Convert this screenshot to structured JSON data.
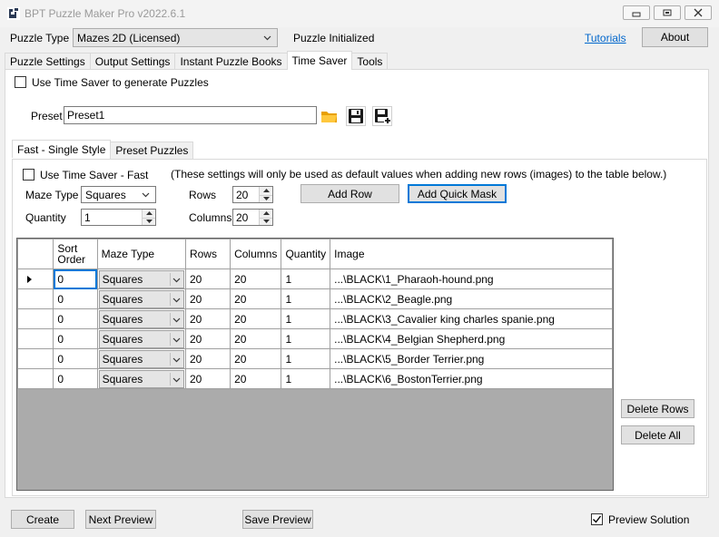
{
  "window": {
    "title": "BPT Puzzle Maker Pro v2022.6.1",
    "icon": "puzzle-app-icon",
    "controls": [
      "minimize-icon",
      "maximize-icon",
      "close-icon"
    ]
  },
  "top": {
    "puzzle_type_label": "Puzzle Type",
    "puzzle_type_value": "Mazes 2D (Licensed)",
    "status": "Puzzle Initialized",
    "tutorials_link": "Tutorials",
    "about_button": "About"
  },
  "main_tabs": [
    "Puzzle Settings",
    "Output Settings",
    "Instant Puzzle Books",
    "Time Saver",
    "Tools"
  ],
  "main_tabs_active": "Time Saver",
  "time_saver": {
    "use_checkbox_label": "Use Time Saver to generate Puzzles",
    "use_checked": false,
    "preset_label": "Preset",
    "preset_value": "Preset1",
    "preset_icons": [
      "open-folder-icon",
      "save-icon",
      "save-as-icon"
    ],
    "sub_tabs": [
      "Fast - Single Style",
      "Preset Puzzles"
    ],
    "sub_tabs_active": "Fast - Single Style",
    "fast": {
      "use_fast_label": "Use Time Saver - Fast",
      "use_fast_checked": false,
      "note": "(These settings will only be used as default values when adding new rows (images) to the table below.)",
      "maze_type_label": "Maze Type",
      "maze_type_value": "Squares",
      "quantity_label": "Quantity",
      "quantity_value": "1",
      "rows_label": "Rows",
      "rows_value": "20",
      "columns_label": "Columns",
      "columns_value": "20",
      "add_row_button": "Add Row",
      "add_quick_mask_button": "Add Quick Mask"
    },
    "table": {
      "columns": [
        "Sort Order",
        "Maze Type",
        "Rows",
        "Columns",
        "Quantity",
        "Image"
      ],
      "rows": [
        {
          "sort": "0",
          "maze_type": "Squares",
          "rows": "20",
          "columns": "20",
          "quantity": "1",
          "image": "...\\BLACK\\1_Pharaoh-hound.png"
        },
        {
          "sort": "0",
          "maze_type": "Squares",
          "rows": "20",
          "columns": "20",
          "quantity": "1",
          "image": "...\\BLACK\\2_Beagle.png"
        },
        {
          "sort": "0",
          "maze_type": "Squares",
          "rows": "20",
          "columns": "20",
          "quantity": "1",
          "image": "...\\BLACK\\3_Cavalier king charles spanie.png"
        },
        {
          "sort": "0",
          "maze_type": "Squares",
          "rows": "20",
          "columns": "20",
          "quantity": "1",
          "image": "...\\BLACK\\4_Belgian Shepherd.png"
        },
        {
          "sort": "0",
          "maze_type": "Squares",
          "rows": "20",
          "columns": "20",
          "quantity": "1",
          "image": "...\\BLACK\\5_Border Terrier.png"
        },
        {
          "sort": "0",
          "maze_type": "Squares",
          "rows": "20",
          "columns": "20",
          "quantity": "1",
          "image": "...\\BLACK\\6_BostonTerrier.png"
        }
      ]
    },
    "delete_rows_button": "Delete Rows",
    "delete_all_button": "Delete All"
  },
  "bottom": {
    "create_button": "Create",
    "next_preview_button": "Next Preview",
    "save_preview_button": "Save Preview",
    "preview_solution_label": "Preview Solution",
    "preview_solution_checked": true
  }
}
